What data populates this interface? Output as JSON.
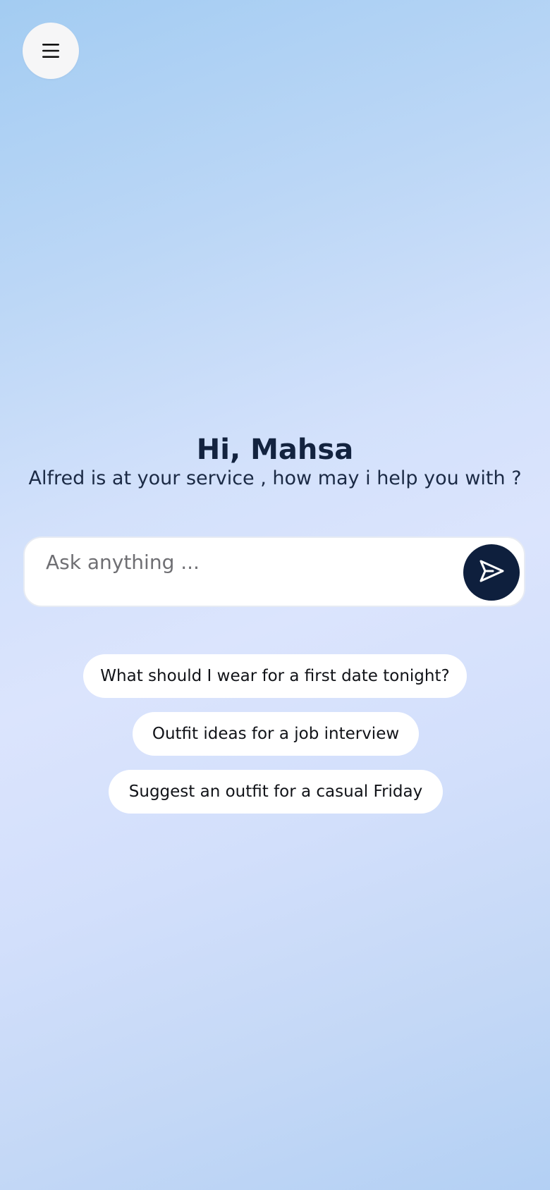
{
  "menu": {
    "icon": "menu-icon"
  },
  "greeting": {
    "title": "Hi, Mahsa",
    "subtitle": "Alfred is at your service , how may i help you with ?"
  },
  "chat_input": {
    "placeholder": "Ask anything ...",
    "value": "",
    "send_icon": "send-icon"
  },
  "suggestions": [
    {
      "label": "What should I wear for a first date tonight?"
    },
    {
      "label": "Outfit ideas for a job interview"
    },
    {
      "label": "Suggest an outfit for a casual Friday"
    }
  ],
  "colors": {
    "accent": "#0e1f3d",
    "heading": "#13233f",
    "background_top": "#a3ccf2",
    "background_mid": "#dbe4fd",
    "background_bottom": "#b3d0f4"
  }
}
